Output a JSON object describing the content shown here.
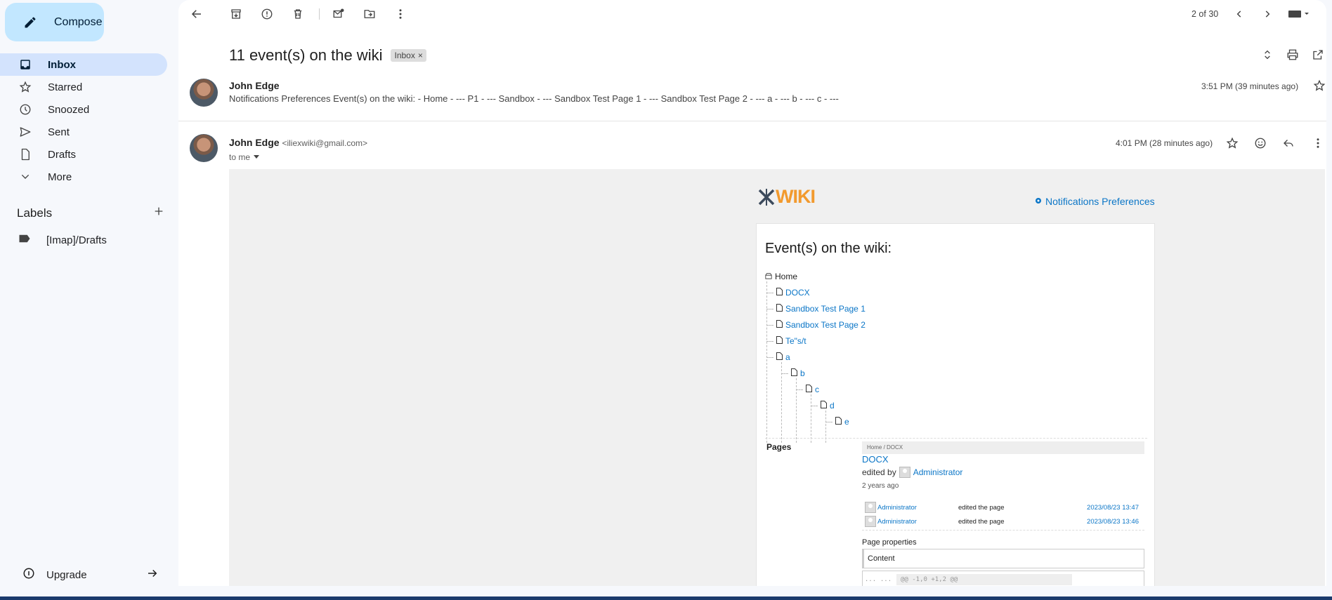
{
  "sidebar": {
    "compose_label": "Compose",
    "items": [
      {
        "label": "Inbox",
        "icon": "inbox-icon"
      },
      {
        "label": "Starred",
        "icon": "star-icon"
      },
      {
        "label": "Snoozed",
        "icon": "clock-icon"
      },
      {
        "label": "Sent",
        "icon": "send-icon"
      },
      {
        "label": "Drafts",
        "icon": "draft-icon"
      },
      {
        "label": "More",
        "icon": "chevron-down-icon"
      }
    ],
    "labels_title": "Labels",
    "labels": [
      {
        "label": "[Imap]/Drafts"
      }
    ],
    "upgrade_label": "Upgrade"
  },
  "toolbar": {
    "pager": "2 of 30"
  },
  "thread": {
    "subject": "11 event(s) on the wiki",
    "chip": "Inbox",
    "chip_close": "×"
  },
  "message1": {
    "sender": "John Edge",
    "snippet": "Notifications Preferences Event(s) on the wiki: - Home - --- P1 - --- Sandbox - --- Sandbox Test Page 1 - --- Sandbox Test Page 2 - --- a - --- b - --- c - ---",
    "time": "3:51 PM (39 minutes ago)"
  },
  "message2": {
    "sender": "John Edge",
    "email": "<iliexwiki@gmail.com>",
    "to": "to me",
    "time": "4:01 PM (28 minutes ago)"
  },
  "email_body": {
    "logo_text": "WIKI",
    "notif_pref": "Notifications Preferences",
    "heading": "Event(s) on the wiki:",
    "tree_root": "Home",
    "tree": [
      {
        "label": "DOCX",
        "level": 1
      },
      {
        "label": "Sandbox Test Page 1",
        "level": 1
      },
      {
        "label": "Sandbox Test Page 2",
        "level": 1
      },
      {
        "label": "Te\"s/t",
        "level": 1
      },
      {
        "label": "a",
        "level": 1
      },
      {
        "label": "b",
        "level": 2
      },
      {
        "label": "c",
        "level": 3
      },
      {
        "label": "d",
        "level": 4
      },
      {
        "label": "e",
        "level": 5
      }
    ],
    "pages_title": "Pages",
    "breadcrumb": "Home / DOCX",
    "page_link": "DOCX",
    "edited_by": "edited by",
    "editor": "Administrator",
    "ago": "2 years ago",
    "history": [
      {
        "who": "Administrator",
        "action": "edited the page",
        "when": "2023/08/23 13:47"
      },
      {
        "who": "Administrator",
        "action": "edited the page",
        "when": "2023/08/23 13:46"
      }
    ],
    "page_props": "Page properties",
    "content_label": "Content",
    "diff_dots1": "...",
    "diff_dots2": "...",
    "diff_hunk": "@@ -1,0 +1,2 @@"
  },
  "colors": {
    "accent": "#c2e7ff",
    "active_nav": "#d3e3fd",
    "link": "#0b76c7",
    "logo": "#f29a2e"
  }
}
